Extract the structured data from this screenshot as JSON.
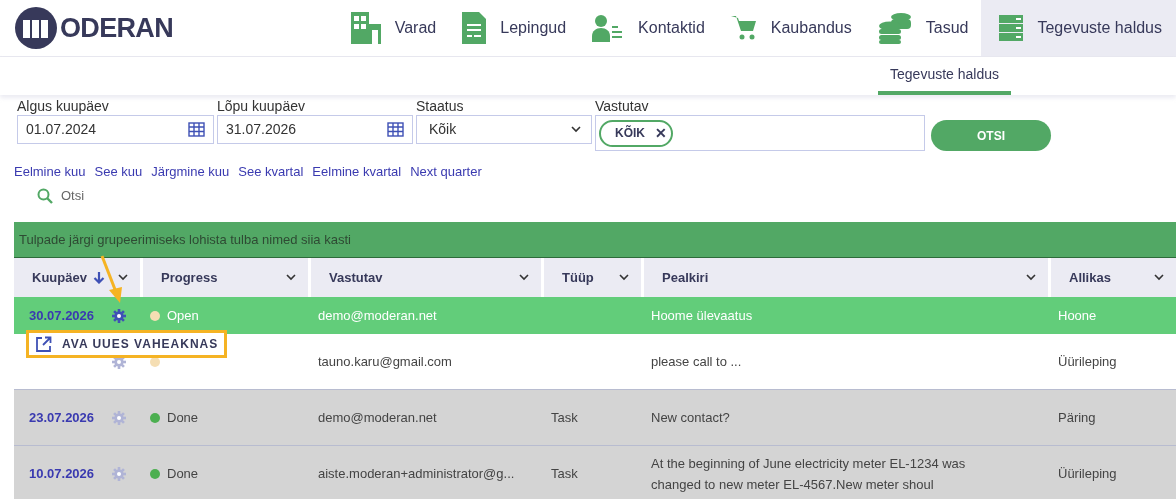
{
  "logo": "ODERAN",
  "nav": [
    {
      "label": "Varad",
      "selected": false
    },
    {
      "label": "Lepingud",
      "selected": false
    },
    {
      "label": "Kontaktid",
      "selected": false
    },
    {
      "label": "Kaubandus",
      "selected": false
    },
    {
      "label": "Tasud",
      "selected": false
    },
    {
      "label": "Tegevuste haldus",
      "selected": true
    }
  ],
  "subnav": [
    {
      "label": "Tegevuste haldus",
      "selected": true
    }
  ],
  "filters": {
    "start": {
      "label": "Algus kuupäev",
      "value": "01.07.2024"
    },
    "end": {
      "label": "Lõpu kuupäev",
      "value": "31.07.2026"
    },
    "status": {
      "label": "Staatus",
      "value": "Kõik"
    },
    "responsible": {
      "label": "Vastutav",
      "chips": [
        "KÕIK"
      ],
      "chip_remove": "✕"
    },
    "search_button": "OTSI"
  },
  "quick_links": [
    "Eelmine kuu",
    "See kuu",
    "Järgmine kuu",
    "See kvartal",
    "Eelmine kvartal",
    "Next quarter"
  ],
  "search_link": "Otsi",
  "group_bar": "Tulpade järgi grupeerimiseks lohista tulba nimed siia kasti",
  "table": {
    "columns": [
      {
        "label": "Kuupäev",
        "sorted": true
      },
      {
        "label": "Progress",
        "sorted": false
      },
      {
        "label": "Vastutav",
        "sorted": false
      },
      {
        "label": "Tüüp",
        "sorted": false
      },
      {
        "label": "Pealkiri",
        "sorted": false
      },
      {
        "label": "Allikas",
        "sorted": false
      }
    ],
    "rows": [
      {
        "selected": true,
        "kind": "open",
        "date": "30.07.2026",
        "progress": "Open",
        "color": "#f5deb3",
        "responsible": "demo@moderan.net",
        "title": "Hoome ülevaatus",
        "source": "Hoone"
      },
      {
        "selected": false,
        "kind": "open",
        "color": "#f5deb3",
        "responsible": "tauno.karu@gmail.com",
        "title": "please call to ...",
        "source": "Üürileping"
      },
      {
        "selected": false,
        "kind": "done",
        "date": "23.07.2026",
        "progress": "Done",
        "color": "#4caf50",
        "responsible": "demo@moderan.net",
        "type": "Task",
        "title": "New contact?",
        "source": "Päring"
      },
      {
        "selected": false,
        "kind": "done",
        "date": "10.07.2026",
        "progress": "Done",
        "color": "#4caf50",
        "responsible": "aiste.moderan+administrator@g...",
        "type": "Task",
        "title": "At the beginning of June electricity meter EL-1234 was changed to new meter EL-4567.New meter shoul",
        "source": "Üürileping"
      }
    ]
  },
  "popup": {
    "label": "AVA UUES VAHEAKNAS"
  }
}
